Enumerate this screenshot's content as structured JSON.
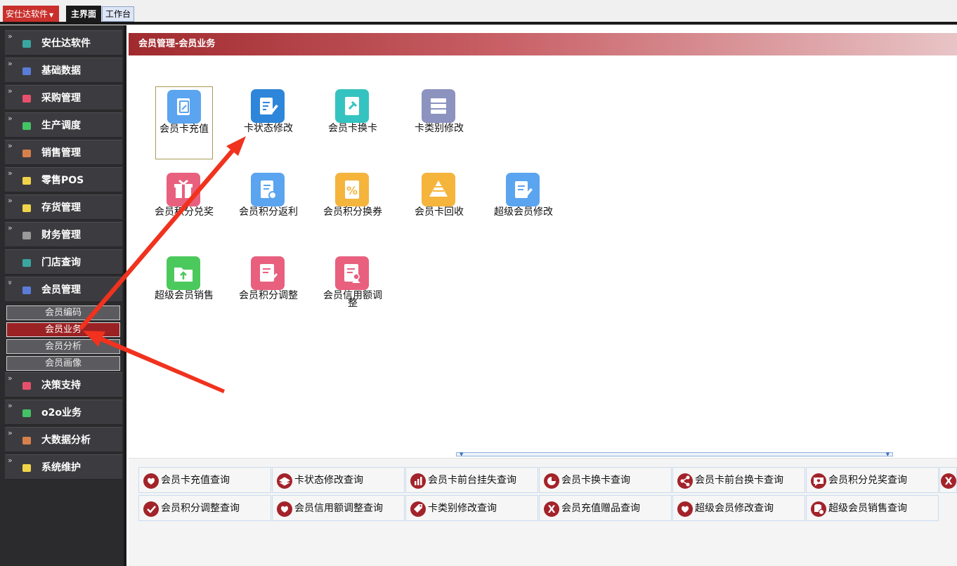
{
  "topbar": {
    "app_menu": "安仕达软件",
    "tab_main": "主界面",
    "tab_work": "工作台"
  },
  "sidebar": {
    "items": [
      {
        "label": "安仕达软件",
        "color": "#3aa6a0"
      },
      {
        "label": "基础数据",
        "color": "#5a7cd8"
      },
      {
        "label": "采购管理",
        "color": "#e6506c"
      },
      {
        "label": "生产调度",
        "color": "#44c266"
      },
      {
        "label": "销售管理",
        "color": "#d8804c"
      },
      {
        "label": "零售POS",
        "color": "#f0d34a"
      },
      {
        "label": "存货管理",
        "color": "#f0d34a"
      },
      {
        "label": "财务管理",
        "color": "#9a9a9a"
      },
      {
        "label": "门店查询",
        "color": "#3aa6a0"
      },
      {
        "label": "会员管理",
        "color": "#5a7cd8"
      },
      {
        "label": "决策支持",
        "color": "#e6506c"
      },
      {
        "label": "o2o业务",
        "color": "#44c266"
      },
      {
        "label": "大数据分析",
        "color": "#d8804c"
      },
      {
        "label": "系统维护",
        "color": "#f0d34a"
      }
    ],
    "sub_items": [
      "会员编码",
      "会员业务",
      "会员分析",
      "会员画像"
    ]
  },
  "main": {
    "title": "会员管理-会员业务",
    "tiles": [
      {
        "label": "会员卡充值",
        "color": "#5ba4ef",
        "icon": "card-recharge-icon"
      },
      {
        "label": "卡状态修改",
        "color": "#2d86d9",
        "icon": "edit-note-icon"
      },
      {
        "label": "会员卡换卡",
        "color": "#34c3c0",
        "icon": "pin-card-icon"
      },
      {
        "label": "卡类别修改",
        "color": "#8c93bf",
        "icon": "server-list-icon"
      },
      {
        "label": "会员积分兑奖",
        "color": "#e8607e",
        "icon": "gift-icon"
      },
      {
        "label": "会员积分返利",
        "color": "#5ba4ef",
        "icon": "doc-gear-icon"
      },
      {
        "label": "会员积分换券",
        "color": "#f5b43c",
        "icon": "percent-coupon-icon"
      },
      {
        "label": "会员卡回收",
        "color": "#f5b43c",
        "icon": "pyramid-icon"
      },
      {
        "label": "超级会员修改",
        "color": "#5ba4ef",
        "icon": "edit-pen-icon"
      },
      {
        "label": "超级会员销售",
        "color": "#4cc95c",
        "icon": "folder-upload-icon"
      },
      {
        "label": "会员积分调整",
        "color": "#e8607e",
        "icon": "doc-check-icon"
      },
      {
        "label": "会员信用额调整",
        "color": "#e8607e",
        "icon": "doc-user-icon"
      }
    ]
  },
  "queries": [
    {
      "label": "会员卡充值查询",
      "icon": "hearts-icon"
    },
    {
      "label": "卡状态修改查询",
      "icon": "layers-icon"
    },
    {
      "label": "会员卡前台挂失查询",
      "icon": "bar-chart-icon"
    },
    {
      "label": "会员卡换卡查询",
      "icon": "pie-chart-icon"
    },
    {
      "label": "会员卡前台换卡查询",
      "icon": "network-icon"
    },
    {
      "label": "会员积分兑奖查询",
      "icon": "chat-heart-icon"
    },
    {
      "label": "",
      "icon": "x-icon"
    },
    {
      "label": "会员积分调整查询",
      "icon": "check-icon"
    },
    {
      "label": "会员信用额调整查询",
      "icon": "hearts-icon"
    },
    {
      "label": "卡类别修改查询",
      "icon": "tag-icon"
    },
    {
      "label": "会员充值赠品查询",
      "icon": "x-icon"
    },
    {
      "label": "超级会员修改查询",
      "icon": "hearts-icon"
    },
    {
      "label": "超级会员销售查询",
      "icon": "database-icon"
    }
  ]
}
